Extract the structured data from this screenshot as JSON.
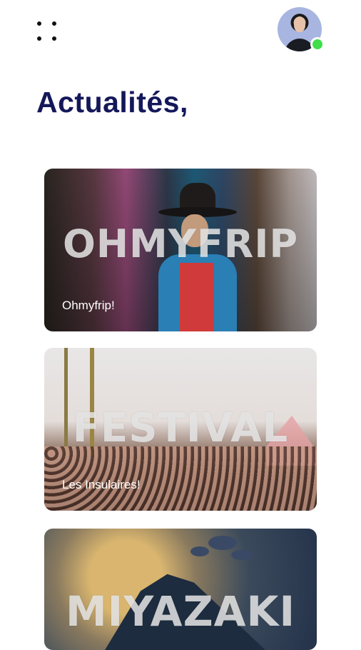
{
  "header": {
    "menu_icon": "grid-dots-icon",
    "avatar_status_color": "#3fde4a"
  },
  "page": {
    "title": "Actualités,"
  },
  "cards": [
    {
      "headline": "OHMYFRIP",
      "subtitle": "Ohmyfrip!"
    },
    {
      "headline": "FESTIVAL",
      "subtitle": "Les Insulaires!"
    },
    {
      "headline": "MIYAZAKI"
    }
  ],
  "colors": {
    "title": "#14185a",
    "background": "#ffffff"
  }
}
